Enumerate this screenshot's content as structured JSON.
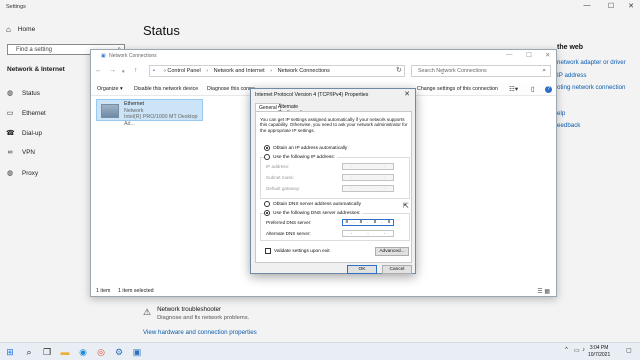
{
  "settings": {
    "window_title": "Settings",
    "home": "Home",
    "search_placeholder": "Find a setting",
    "section": "Network & Internet",
    "nav": [
      {
        "label": "Status",
        "icon": "globe-icon"
      },
      {
        "label": "Ethernet",
        "icon": "ethernet-icon"
      },
      {
        "label": "Dial-up",
        "icon": "phone-icon"
      },
      {
        "label": "VPN",
        "icon": "vpn-icon"
      },
      {
        "label": "Proxy",
        "icon": "globe-icon"
      }
    ],
    "page_title": "Status",
    "right_heading": "the web",
    "right_links": [
      "network adapter or driver",
      "IP address",
      "oting network connection",
      "elp",
      "eedback"
    ],
    "troubleshooter": {
      "title": "Network troubleshooter",
      "subtitle": "Diagnose and fix network problems."
    },
    "hardware_link": "View hardware and connection properties"
  },
  "network_connections": {
    "window_title": "Network Connections",
    "breadcrumb": [
      "Control Panel",
      "Network and Internet",
      "Network Connections"
    ],
    "search_placeholder": "Search Network Connections",
    "commands": [
      "Organize ▾",
      "Disable this network device",
      "Diagnose this conne",
      "Change settings of this connection"
    ],
    "adapter": {
      "name": "Ethernet",
      "status": "Network",
      "device": "Intel(R) PRO/1000 MT Desktop Ad..."
    },
    "status_bar": {
      "count": "1 item",
      "selected": "1 item selected"
    }
  },
  "ipv4_dialog": {
    "title": "Internet Protocol Version 4 (TCP/IPv4) Properties",
    "tabs": [
      "General",
      "Alternate Configuration"
    ],
    "description": "You can get IP settings assigned automatically if your network supports this capability. Otherwise, you need to ask your network administrator for the appropriate IP settings.",
    "ip_auto": "Obtain an IP address automatically",
    "ip_manual": "Use the following IP address:",
    "ip_fields": {
      "ip_address": "IP address:",
      "subnet_mask": "Subnet mask:",
      "default_gateway": "Default gateway:"
    },
    "dns_auto": "Obtain DNS server address automatically",
    "dns_manual": "Use the following DNS server addresses:",
    "preferred_dns_label": "Preferred DNS server:",
    "preferred_dns_octets": [
      "8",
      "8",
      "8",
      "8"
    ],
    "alternate_dns_label": "Alternate DNS server:",
    "validate": "Validate settings upon exit",
    "advanced": "Advanced...",
    "ok": "OK",
    "cancel": "Cancel"
  },
  "taskbar": {
    "time": "3:04 PM",
    "date": "10/7/2021"
  }
}
